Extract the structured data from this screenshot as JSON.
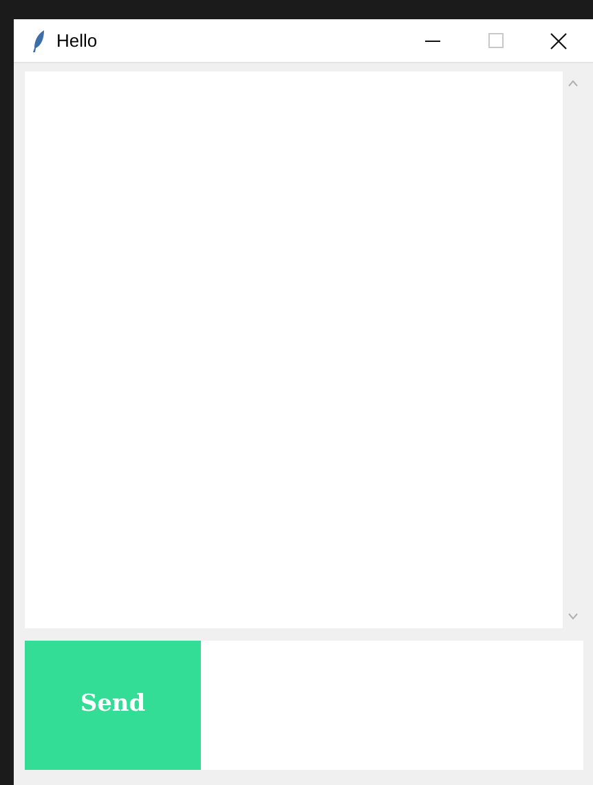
{
  "window": {
    "title": "Hello"
  },
  "send_button": {
    "label": "Send"
  }
}
